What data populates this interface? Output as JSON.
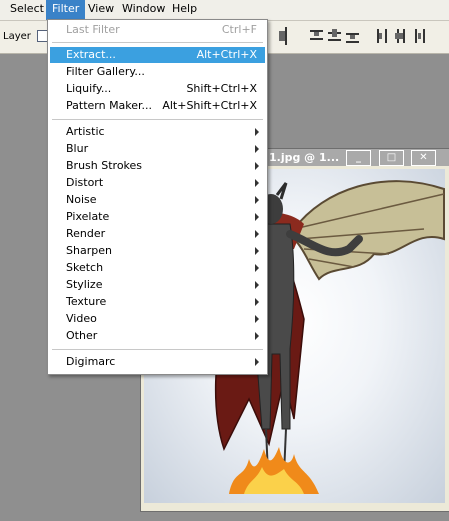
{
  "menubar": {
    "items": [
      {
        "label": "Select"
      },
      {
        "label": "Filter"
      },
      {
        "label": "View"
      },
      {
        "label": "Window"
      },
      {
        "label": "Help"
      }
    ],
    "active_index": 1
  },
  "options": {
    "layer_label": "Layer"
  },
  "document": {
    "title": "1.jpg @ 1...",
    "minimize": "_",
    "maximize": "□",
    "close": "✕"
  },
  "filter_menu": {
    "top_items": [
      {
        "label": "Last Filter",
        "shortcut": "Ctrl+F",
        "disabled": true
      }
    ],
    "group1": [
      {
        "label": "Extract...",
        "shortcut": "Alt+Ctrl+X",
        "highlight": true
      },
      {
        "label": "Filter Gallery...",
        "shortcut": ""
      },
      {
        "label": "Liquify...",
        "shortcut": "Shift+Ctrl+X"
      },
      {
        "label": "Pattern Maker...",
        "shortcut": "Alt+Shift+Ctrl+X"
      }
    ],
    "submenus": [
      {
        "label": "Artistic"
      },
      {
        "label": "Blur"
      },
      {
        "label": "Brush Strokes"
      },
      {
        "label": "Distort"
      },
      {
        "label": "Noise"
      },
      {
        "label": "Pixelate"
      },
      {
        "label": "Render"
      },
      {
        "label": "Sharpen"
      },
      {
        "label": "Sketch"
      },
      {
        "label": "Stylize"
      },
      {
        "label": "Texture"
      },
      {
        "label": "Video"
      },
      {
        "label": "Other"
      }
    ],
    "bottom": [
      {
        "label": "Digimarc"
      }
    ]
  },
  "colors": {
    "menu_highlight": "#3ba0e0",
    "menubar_active": "#3a82c8",
    "workspace": "#8f8f8f"
  }
}
